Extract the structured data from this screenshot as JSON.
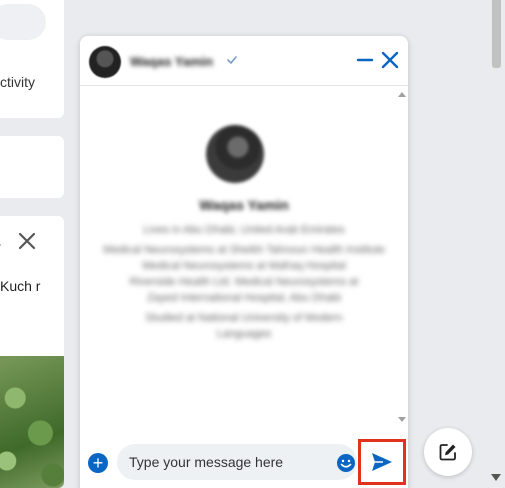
{
  "feed": {
    "activity_text": "ctivity",
    "post_snippet": "Kuch r"
  },
  "chat": {
    "contact_name": "Waqas Yamin",
    "profile": {
      "name": "Waqas Yamin",
      "lines": [
        "Lives in Abu Dhabi, United Arab Emirates",
        "Medical Neurosystems at Sheikh Tahnoun Health Institute",
        "Medical Neurosystems at Mafraq Hospital",
        "Riverside Health Ltd. Medical Neurosystems at",
        "Zayed International Hospital, Abu Dhabi",
        "Studied at National University of Modern",
        "Languages"
      ]
    },
    "composer": {
      "placeholder": "Type your message here"
    }
  },
  "colors": {
    "accent": "#0a66c2",
    "highlight": "#e0321e",
    "page_bg": "#e9ebee"
  },
  "icons": {
    "minimize": "minus-icon",
    "close": "close-icon",
    "verified": "verified-check-icon",
    "add": "plus-icon",
    "emoji": "emoji-icon",
    "send": "send-icon",
    "compose": "compose-icon"
  }
}
